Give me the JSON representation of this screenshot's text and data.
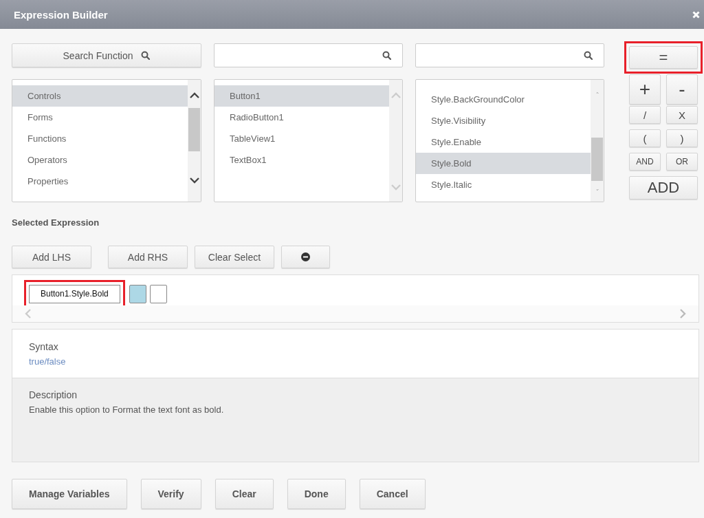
{
  "window": {
    "title": "Expression Builder"
  },
  "search_function_button": {
    "label": "Search Function"
  },
  "lists": [
    {
      "scrollable": true,
      "items": [
        {
          "label": "Controls",
          "selected": true
        },
        {
          "label": "Forms",
          "selected": false
        },
        {
          "label": "Functions",
          "selected": false
        },
        {
          "label": "Operators",
          "selected": false
        },
        {
          "label": "Properties",
          "selected": false
        }
      ]
    },
    {
      "scrollable": false,
      "items": [
        {
          "label": "Button1",
          "selected": true
        },
        {
          "label": "RadioButton1",
          "selected": false
        },
        {
          "label": "TableView1",
          "selected": false
        },
        {
          "label": "TextBox1",
          "selected": false
        }
      ]
    },
    {
      "scrollable": true,
      "items": [
        {
          "label": "Style.BackGroundColor",
          "selected": false
        },
        {
          "label": "Style.Visibility",
          "selected": false
        },
        {
          "label": "Style.Enable",
          "selected": false
        },
        {
          "label": "Style.Bold",
          "selected": true
        },
        {
          "label": "Style.Italic",
          "selected": false
        }
      ]
    }
  ],
  "operator_buttons": [
    {
      "label": "=",
      "kind": "wide",
      "highlighted": true
    },
    {
      "label": "+",
      "kind": "large",
      "highlighted": false
    },
    {
      "label": "-",
      "kind": "large",
      "highlighted": false
    },
    {
      "label": "/",
      "kind": "normal",
      "highlighted": false
    },
    {
      "label": "X",
      "kind": "normal",
      "highlighted": false
    },
    {
      "label": "(",
      "kind": "normal",
      "highlighted": false
    },
    {
      "label": ")",
      "kind": "normal",
      "highlighted": false
    },
    {
      "label": "AND",
      "kind": "small",
      "highlighted": false
    },
    {
      "label": "OR",
      "kind": "small",
      "highlighted": false
    },
    {
      "label": "ADD",
      "kind": "wide-large",
      "highlighted": false
    }
  ],
  "selected_expression": {
    "heading": "Selected Expression",
    "buttons": [
      {
        "kind": "text",
        "label": "Add LHS"
      },
      {
        "kind": "text",
        "label": "Add RHS"
      },
      {
        "kind": "text",
        "label": "Clear Select"
      },
      {
        "kind": "remove"
      }
    ],
    "tokens": [
      {
        "kind": "text",
        "label": "Button1.Style.Bold",
        "highlighted": true
      },
      {
        "kind": "slot",
        "selected": true
      },
      {
        "kind": "slot",
        "selected": false
      }
    ]
  },
  "syntax": {
    "heading": "Syntax",
    "value": "true/false"
  },
  "description": {
    "heading": "Description",
    "text": "Enable this option to Format the text font as bold."
  },
  "footer_buttons": [
    "Manage Variables",
    "Verify",
    "Clear",
    "Done",
    "Cancel"
  ]
}
